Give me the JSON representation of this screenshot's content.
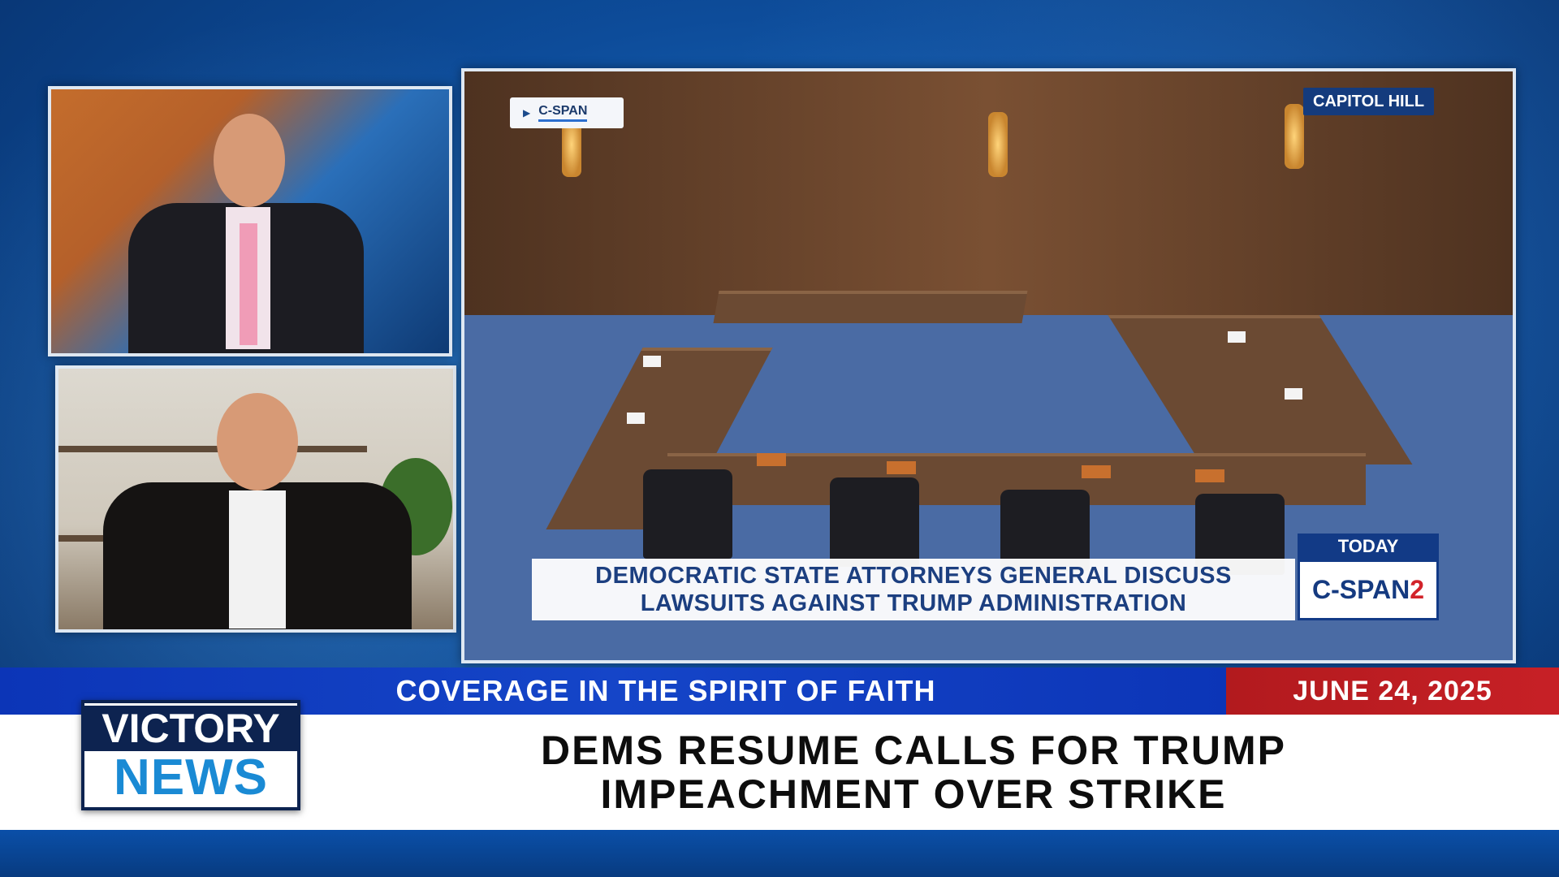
{
  "hearing_feed": {
    "source_bug": "C-SPAN",
    "location_tag": "CAPITOL HILL",
    "headline_line1": "DEMOCRATIC STATE ATTORNEYS GENERAL DISCUSS",
    "headline_line2": "LAWSUITS AGAINST TRUMP ADMINISTRATION",
    "when_tag": "TODAY",
    "network_text": "C-SPAN",
    "network_number": "2"
  },
  "ticker": {
    "tagline": "COVERAGE IN THE SPIRIT OF FAITH",
    "date": "JUNE 24, 2025"
  },
  "story": {
    "headline_line1": "DEMS RESUME CALLS FOR TRUMP",
    "headline_line2": "IMPEACHMENT OVER STRIKE"
  },
  "logo": {
    "line1": "VICTORY",
    "line2": "NEWS"
  },
  "colors": {
    "brand_blue": "#1545c8",
    "brand_red": "#c72026",
    "cspan_navy": "#123a86"
  }
}
